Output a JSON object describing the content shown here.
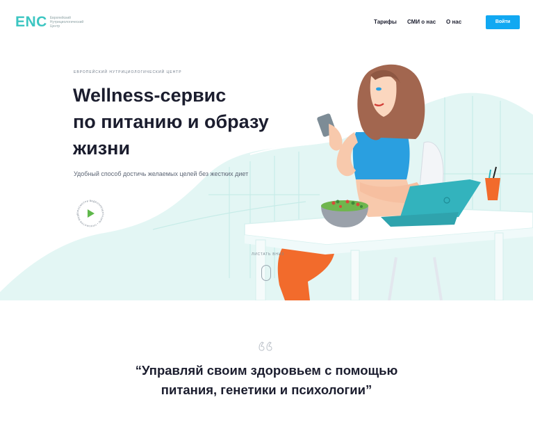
{
  "header": {
    "logo_mark": "ENC",
    "logo_text": "Европейский Нутрициологический Центр",
    "nav": [
      "Тарифы",
      "СМИ о нас",
      "О нас"
    ],
    "login_label": "Войти"
  },
  "hero": {
    "kicker": "ЕВРОПЕЙСКИЙ НУТРИЦИОЛОГИЧЕСКИЙ ЦЕНТР",
    "headline_lines": [
      "Wellness-сервис",
      "по питанию и образу",
      "жизни"
    ],
    "subtitle": "Удобный способ достичь желаемых целей без жестких диет",
    "play_ring_text": "ПРОСМОТРИ ВИДЕОПРЕЗЕНТАЦИЮ • ПРОСМОТРИ ВИДЕОПРЕЗЕНТАЦИЮ •",
    "scroll_hint": "ЛИСТАТЬ ВНИЗ"
  },
  "quote": {
    "lines": [
      "“Управляй своим здоровьем с помощью",
      "питания, генетики и психологии”"
    ]
  },
  "colors": {
    "brand_teal": "#3cc6c2",
    "button_blue": "#11a8f2",
    "hero_bg": "#e3f6f4",
    "play_green": "#5fb84b",
    "text_dark": "#1b1d2e"
  },
  "icons": [
    "play-icon",
    "mouse-scroll-icon",
    "quote-marks-icon"
  ]
}
